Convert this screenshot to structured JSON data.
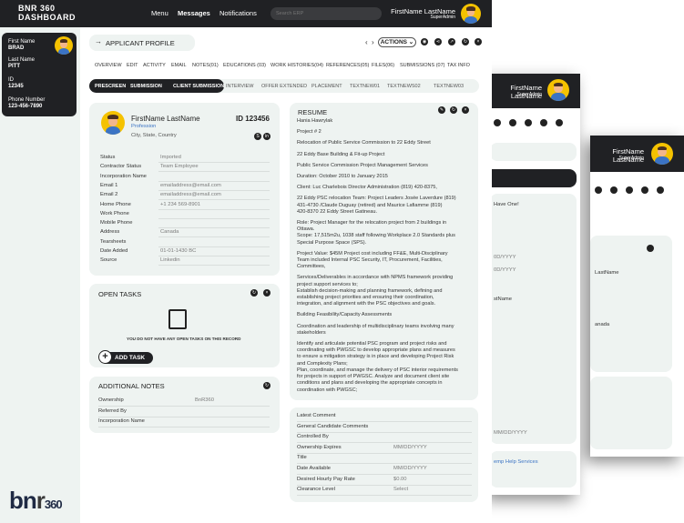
{
  "back_window_2": {
    "user_name": "FirstName LastName",
    "role": "SuperAdmin",
    "visible_texts": [
      "LastName",
      "anada"
    ]
  },
  "back_window_1": {
    "user_name": "FirstName LastName",
    "role": "SuperAdmin",
    "visible_texts": [
      "Have One!",
      "0D/YYYY",
      "0D/YYYY",
      "stName",
      "MM/DD/YYYY",
      "emp Help Services"
    ]
  },
  "header": {
    "title_line1": "BNR 360",
    "title_line2": "DASHBOARD",
    "nav": [
      "Menu",
      "Messages",
      "Notifications"
    ],
    "search_placeholder": "Search ERP",
    "user_name": "FirstName LastName",
    "user_role": "SuperAdmin"
  },
  "sidebar": {
    "fields": [
      {
        "label": "First Name",
        "value": "BRAD"
      },
      {
        "label": "Last Name",
        "value": "PITT"
      },
      {
        "label": "ID",
        "value": "12345"
      },
      {
        "label": "Phone Number",
        "value": "123-456-7890"
      }
    ],
    "logo": "bnr360"
  },
  "profile_header": {
    "title": "APPLICANT PROFILE",
    "actions_label": "ACTIONS"
  },
  "tabs": [
    "OVERVIEW",
    "EDIT",
    "ACTIVITY",
    "EMAIL",
    "NOTES(01)",
    "EDUCATIONS (03)",
    "WORK HISTORIES(04)",
    "REFERENCES(05)",
    "FILES(06)",
    "SUBMISSIONS (07)",
    "TAX INFO"
  ],
  "subtabs": [
    "PRESCREEN",
    "SUBMISSION",
    "CLIENT SUBMISSION",
    "INTERVIEW",
    "OFFER EXTENDED",
    "PLACEMENT",
    "TEXTNEW01",
    "TEXTNEWS02",
    "TEXTNEW03"
  ],
  "candidate": {
    "name": "FirstName LastName",
    "profession": "Profession",
    "location": "City, State, Country",
    "id": "ID 123456"
  },
  "details": [
    {
      "label": "Status",
      "value": "Imported"
    },
    {
      "label": "Contractor Status",
      "value": "Team Employee"
    },
    {
      "label": "Incorporation Name",
      "value": ""
    },
    {
      "label": "Email 1",
      "value": "emailaddress@email.com"
    },
    {
      "label": "Email 2",
      "value": "emailaddress@email.com"
    },
    {
      "label": "Home Phone",
      "value": "+1 234 569-8901"
    },
    {
      "label": "Work Phone",
      "value": ""
    },
    {
      "label": "Mobile Phone",
      "value": ""
    },
    {
      "label": "Address",
      "value": "Canada"
    },
    {
      "label": "Tearsheets",
      "value": ""
    },
    {
      "label": "Date Added",
      "value": "01-01-1430 BC"
    },
    {
      "label": "Source",
      "value": "Linkedin"
    }
  ],
  "open_tasks": {
    "title": "OPEN TASKS",
    "empty_text": "YOU DO NOT HAVE ANY OPEN TASKS ON THIS RECORD",
    "add_label": "ADD TASK"
  },
  "additional_notes": {
    "title": "ADDITIONAL NOTES",
    "rows": [
      {
        "label": "Ownership",
        "value": "BnR360"
      },
      {
        "label": "Referred By",
        "value": ""
      },
      {
        "label": "Incorporation Name",
        "value": ""
      }
    ]
  },
  "resume": {
    "title": "RESUME",
    "paragraphs": [
      "Hania Hawrylak",
      "Project # 2",
      "Relocation of Public Service Commission to 22 Eddy Street",
      "22 Eddy Base Building & Fit-up Project",
      "Public Service Commission Project Management Services",
      "Duration: October 2010 to January 2015",
      "Client: Luc Charlebois Director Administration (819) 420-8375,",
      "22 Eddy PSC relocation Team: Project Leaders Josée Laverdure (819)\n431-4730 /Claude Duguay (retired) and Maurice Lafiamme (819)\n420-8370 22 Eddy Street Gatineau.",
      "Role: Project Manager for the relocation project from 2 buildings in\nOttawa.\nScope: 17,515m2u, 1038 staff following Workplace 2.0 Standards plus\nSpecial Purpose Space (SPS).",
      "Project Value: $45M Project cost including FF&E, Multi-Disciplinary\nTeam included Internal PSC Security, IT, Procurement, Facilities,\nCommittees,",
      "Services/Deliverables in accordance with NPMS framework providing\nproject support services to;\nEstablish decision-making and planning framework, defining and\nestablishing project priorities and ensuring their coordination,\nintegration, and alignment with the PSC objectives and goals.",
      "Building Feasibility/Capacity Assessments",
      "Coordination and leadership of multidisciplinary teams involving many\nstakeholders",
      "Identify and articulate potential PSC program and project risks and\ncoordinating with PWGSC to develop appropriate plans and measures\nto ensure a mitigation strategy is in place and developing Project Risk\nand Complexity Plans;\nPlan, coordinate, and manage the delivery of PSC interior requirements\nfor projects in support of PWGSC. Analyze and document client site\nconditions and plans and developing the appropriate concepts in\ncoordination with PWGSC;"
    ]
  },
  "extra": [
    {
      "label": "Latest Comment",
      "value": ""
    },
    {
      "label": "General Candidate Comments",
      "value": ""
    },
    {
      "label": "Controlled By",
      "value": ""
    },
    {
      "label": "Ownership Expires",
      "value": "MM/DD/YYYY"
    },
    {
      "label": "Title",
      "value": ""
    },
    {
      "label": "Date Available",
      "value": "MM/DD/YYYY"
    },
    {
      "label": "Desired Hourly Pay Rate",
      "value": "$0.00"
    },
    {
      "label": "Clearance Level",
      "value": "Select"
    }
  ],
  "colors": {
    "dark": "#202124",
    "panel": "#eef3f1",
    "accent_blue": "#3b73c4",
    "avatar_bg": "#f5c200"
  }
}
